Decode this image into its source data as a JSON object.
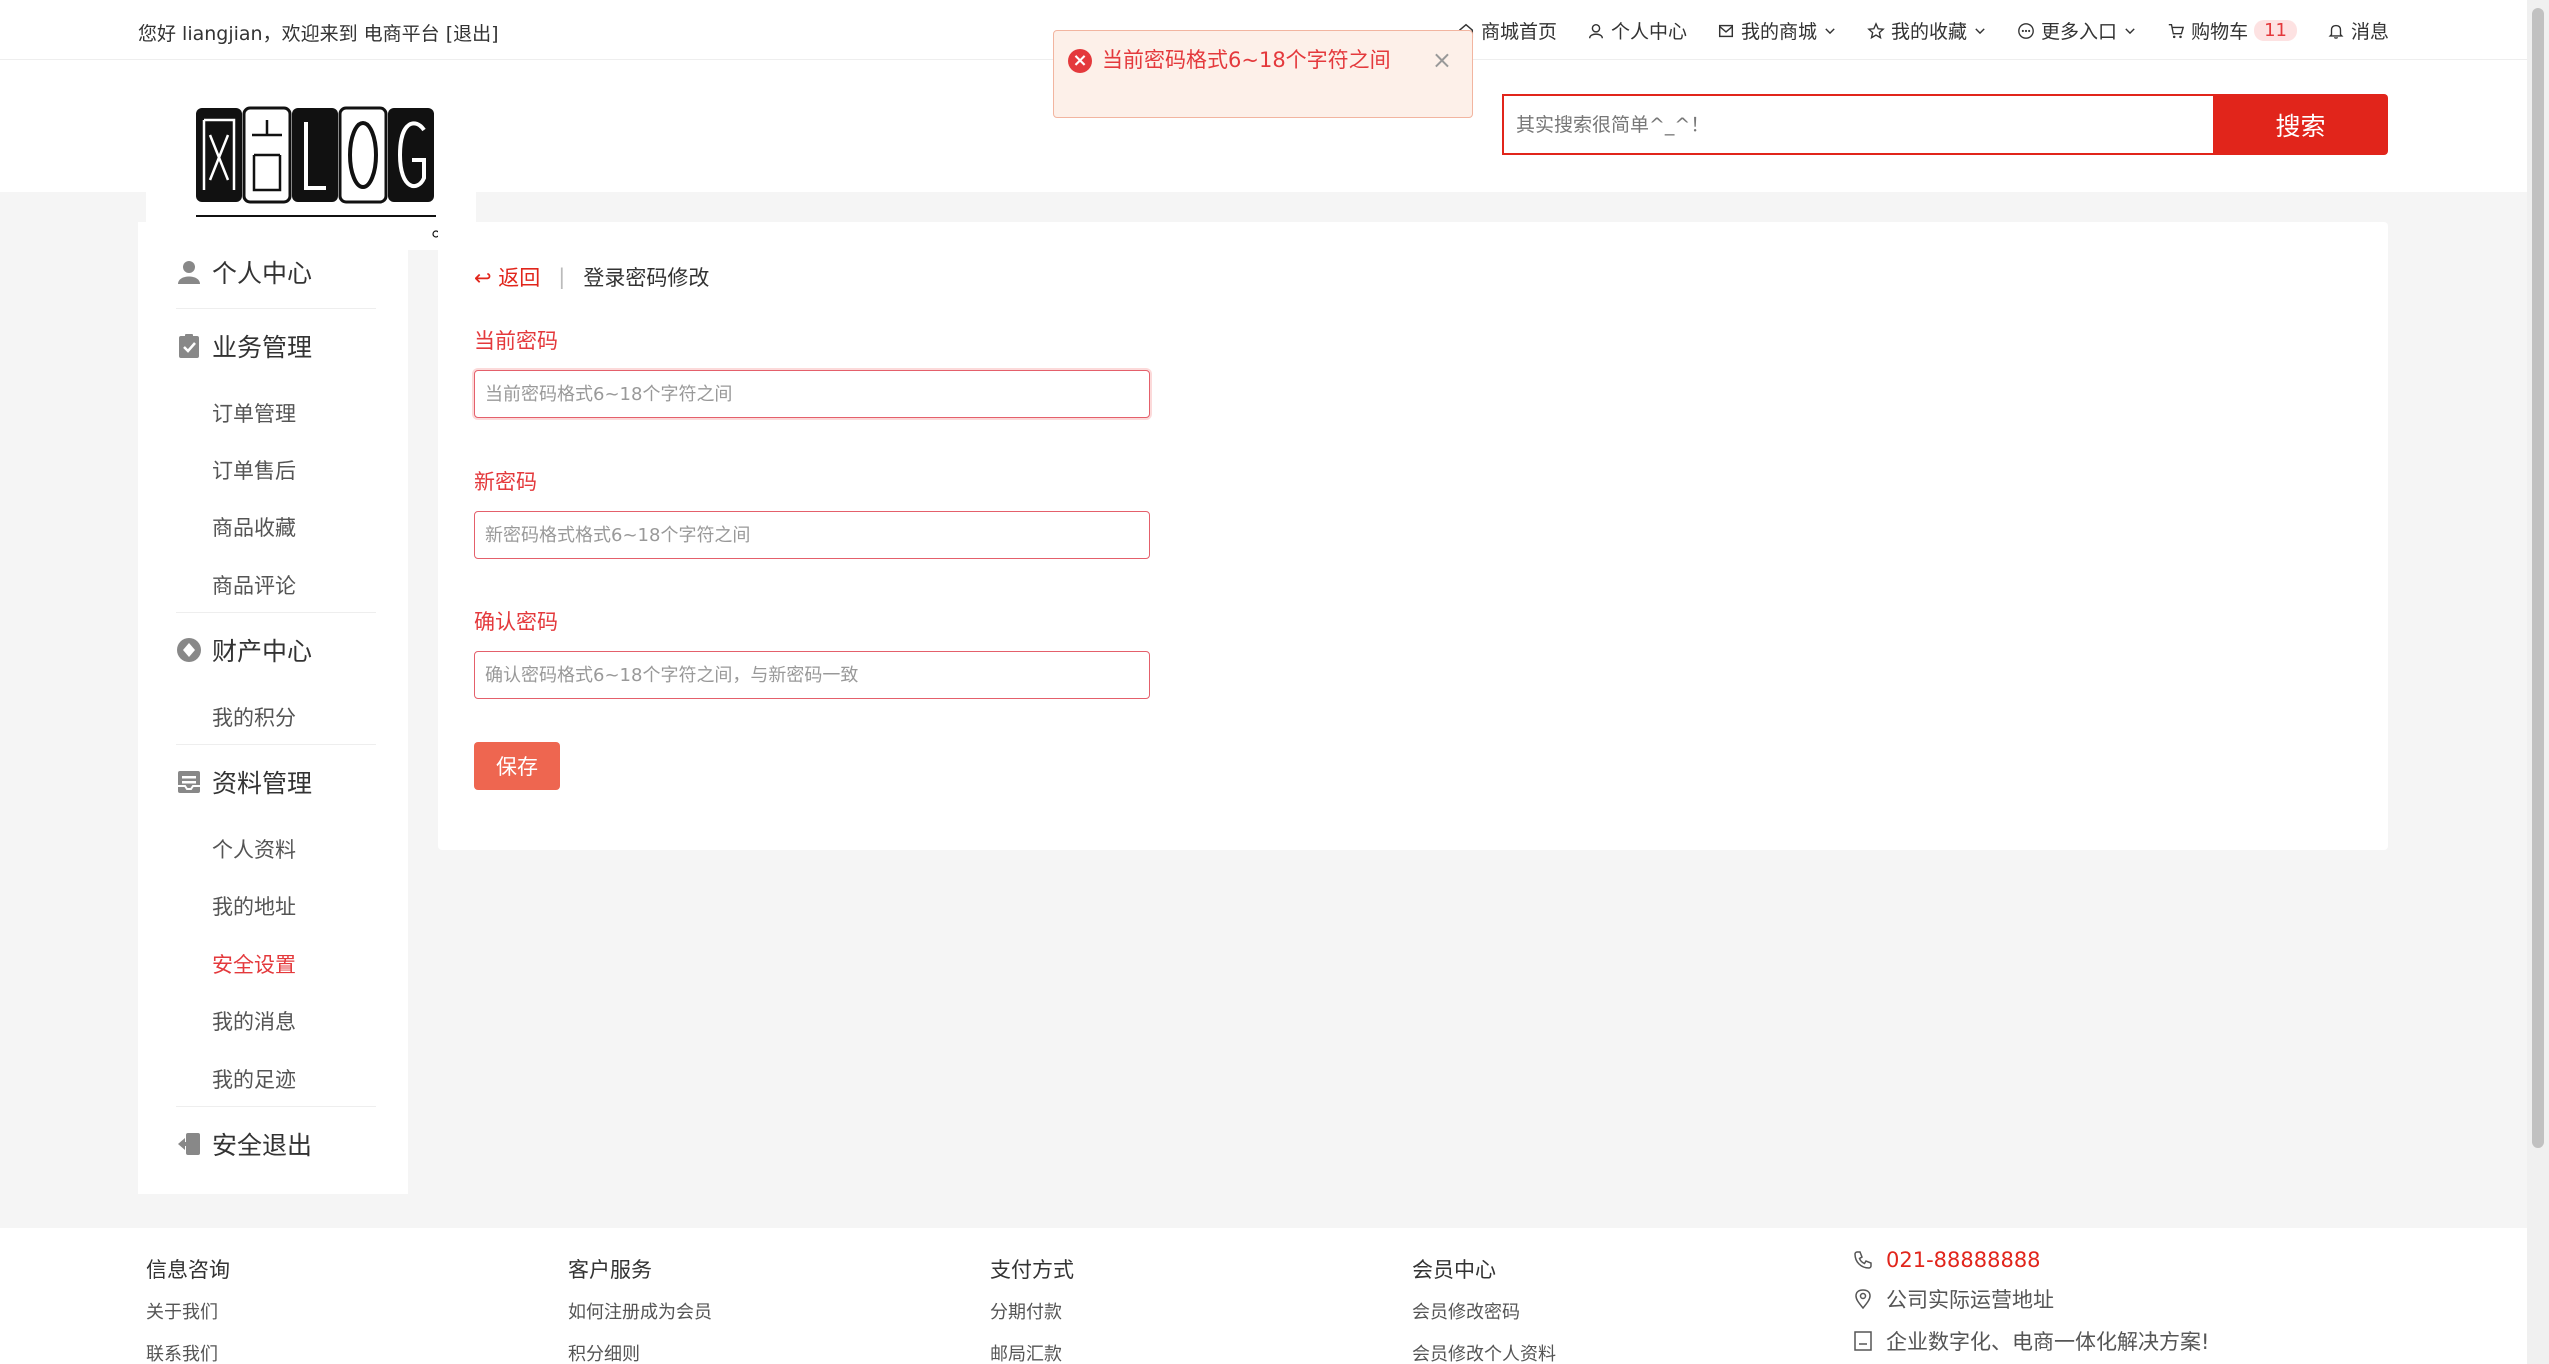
{
  "topbar": {
    "welcome": "您好 liangjian，欢迎来到 电商平台",
    "logout": "[退出]",
    "nav": [
      {
        "label": "商城首页",
        "icon": "home-icon"
      },
      {
        "label": "个人中心",
        "icon": "user-icon"
      },
      {
        "label": "我的商城",
        "icon": "mail-icon"
      },
      {
        "label": "我的收藏",
        "icon": "star-icon"
      },
      {
        "label": "更多入口",
        "icon": "more-icon"
      },
      {
        "label": "购物车",
        "icon": "cart-icon",
        "badge": "11"
      },
      {
        "label": "消息",
        "icon": "bell-icon"
      }
    ]
  },
  "toast": {
    "message": "当前密码格式6~18个字符之间",
    "close": "×"
  },
  "search": {
    "placeholder": "其实搜索很简单^_^！",
    "button": "搜索"
  },
  "sidebar": {
    "groups": [
      {
        "label": "个人中心",
        "icon": "user-icon"
      },
      {
        "label": "业务管理",
        "icon": "clipboard-icon",
        "items": [
          "订单管理",
          "订单售后",
          "商品收藏",
          "商品评论"
        ]
      },
      {
        "label": "财产中心",
        "icon": "diamond-icon",
        "items": [
          "我的积分"
        ]
      },
      {
        "label": "资料管理",
        "icon": "inbox-icon",
        "items": [
          "个人资料",
          "我的地址",
          "安全设置",
          "我的消息",
          "我的足迹"
        ]
      },
      {
        "label": "安全退出",
        "icon": "logout-icon"
      }
    ],
    "active_item": "安全设置"
  },
  "main": {
    "back": "返回",
    "title": "登录密码修改",
    "fields": [
      {
        "label": "当前密码",
        "placeholder": "当前密码格式6~18个字符之间"
      },
      {
        "label": "新密码",
        "placeholder": "新密码格式格式6~18个字符之间"
      },
      {
        "label": "确认密码",
        "placeholder": "确认密码格式6~18个字符之间，与新密码一致"
      }
    ],
    "save": "保存"
  },
  "footer": {
    "columns": [
      {
        "title": "信息咨询",
        "links": [
          "关于我们",
          "联系我们"
        ]
      },
      {
        "title": "客户服务",
        "links": [
          "如何注册成为会员",
          "积分细则"
        ]
      },
      {
        "title": "支付方式",
        "links": [
          "分期付款",
          "邮局汇款"
        ]
      },
      {
        "title": "会员中心",
        "links": [
          "会员修改密码",
          "会员修改个人资料"
        ]
      }
    ],
    "contact": {
      "phone": "021-88888888",
      "address": "公司实际运营地址",
      "slogan": "企业数字化、电商一体化解决方案!"
    }
  },
  "colors": {
    "accent": "#e1251b",
    "error": "#e4393c",
    "save_button": "#ee6650"
  }
}
